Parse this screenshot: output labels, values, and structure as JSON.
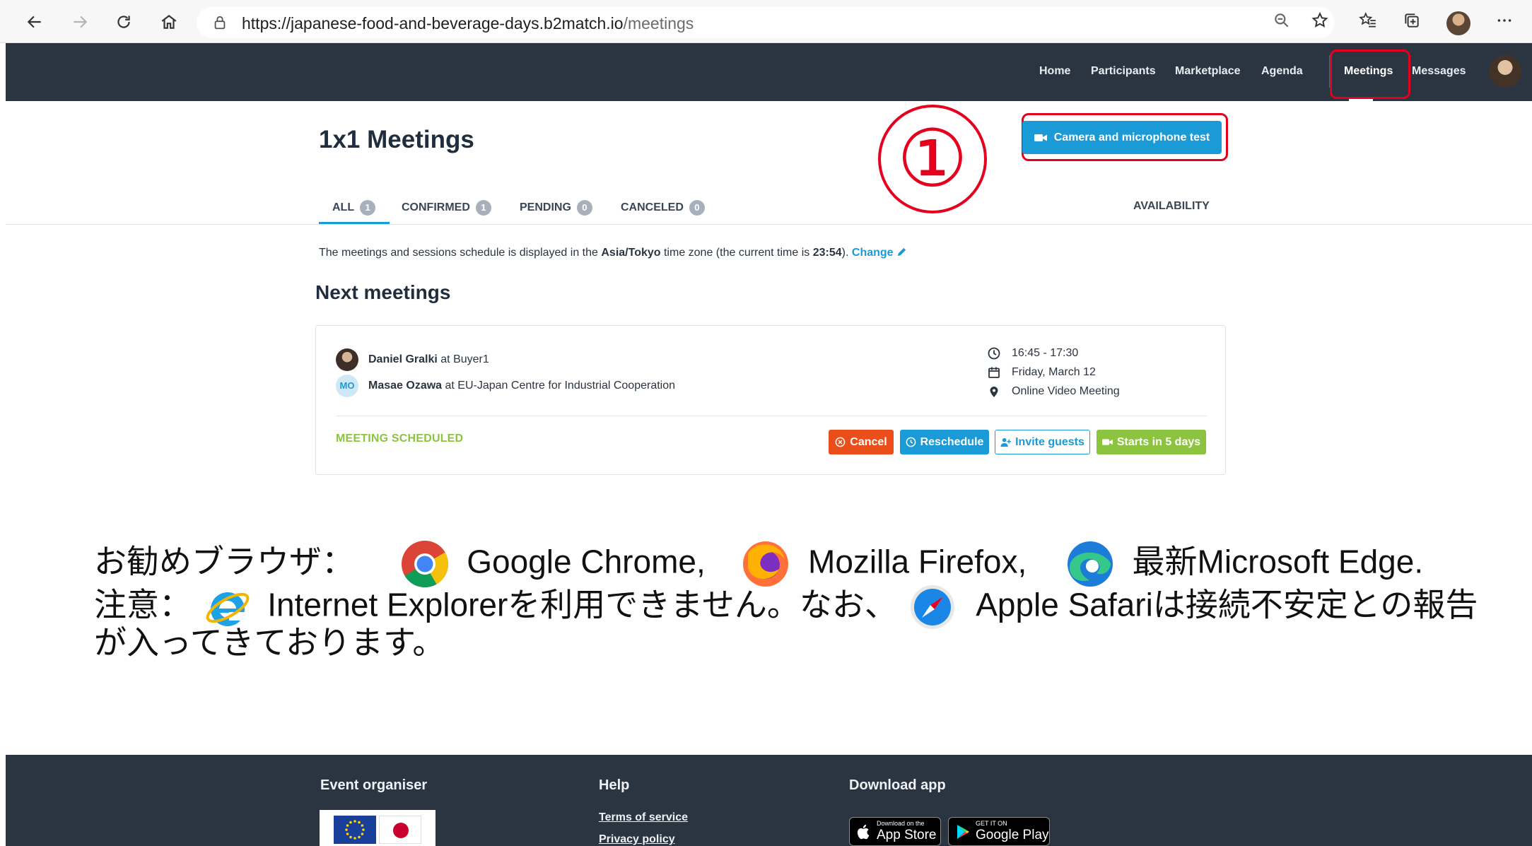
{
  "browser": {
    "url_host": "https://japanese-food-and-beverage-days.b2match.io",
    "url_path": "/meetings"
  },
  "nav": {
    "items": [
      "Home",
      "Participants",
      "Marketplace",
      "Agenda",
      "Meetings",
      "Messages"
    ],
    "active": "Meetings"
  },
  "page": {
    "title": "1x1 Meetings",
    "annotation_number": "①",
    "camera_test_button": "Camera and microphone test"
  },
  "tabs": [
    {
      "label": "ALL",
      "count": "1"
    },
    {
      "label": "CONFIRMED",
      "count": "1"
    },
    {
      "label": "PENDING",
      "count": "0"
    },
    {
      "label": "CANCELED",
      "count": "0"
    }
  ],
  "availability_label": "AVAILABILITY",
  "timezone_notice": {
    "prefix": "The meetings and sessions schedule is displayed in the",
    "zone": "Asia/Tokyo",
    "middle": "time zone (the current time is",
    "time": "23:54",
    "suffix": ").",
    "change_link": "Change"
  },
  "next_meetings": {
    "title": "Next meetings",
    "meeting": {
      "participants": [
        {
          "name": "Daniel Gralki",
          "org": "at Buyer1",
          "avatar": "photo"
        },
        {
          "name": "Masae Ozawa",
          "org": "at EU-Japan Centre for Industrial Cooperation",
          "avatar": "MO"
        }
      ],
      "time": "16:45 - 17:30",
      "date": "Friday, March 12",
      "location": "Online Video Meeting",
      "status": "MEETING SCHEDULED",
      "buttons": {
        "cancel": "Cancel",
        "reschedule": "Reschedule",
        "invite": "Invite guests",
        "starts": "Starts in 5 days"
      }
    }
  },
  "note": {
    "line1_prefix": "お勧めブラウザ：",
    "chrome": "Google Chrome,",
    "firefox": "Mozilla Firefox,",
    "edge": "最新Microsoft Edge.",
    "line2_prefix": "注意：",
    "ie": "Internet Explorerを利用できません。なお、",
    "safari": "Apple Safariは接続不安定との報告",
    "line3": "が入ってきております。"
  },
  "footer": {
    "organiser": "Event organiser",
    "help": "Help",
    "download": "Download app",
    "links": [
      "Terms of service",
      "Privacy policy"
    ],
    "app_store_small": "Download on the",
    "app_store": "App Store",
    "google_play_small": "GET IT ON",
    "google_play": "Google Play"
  },
  "colors": {
    "header_bg": "#2b3441",
    "accent_blue": "#1a9ad6",
    "green": "#8cc43f",
    "cancel_red": "#e94e1b",
    "annotation_red": "#e5001d"
  }
}
